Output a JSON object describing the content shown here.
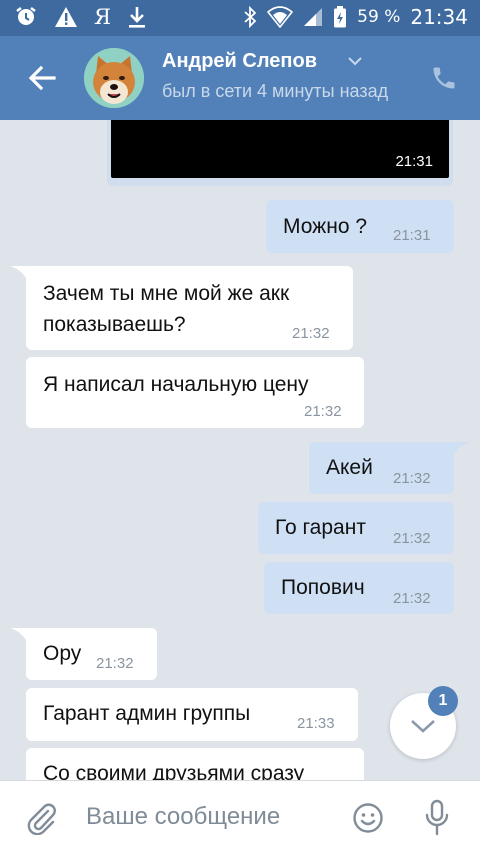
{
  "status_bar": {
    "ya_label": "Я",
    "battery": "59 %",
    "time": "21:34"
  },
  "header": {
    "name": "Андрей Слепов",
    "status": "был в сети 4 минуты назад"
  },
  "chat": {
    "media_time": "21:31",
    "messages": [
      {
        "dir": "out",
        "lines": [
          "Можно ?"
        ],
        "time": "21:31"
      },
      {
        "dir": "in",
        "lines": [
          "Зачем ты мне мой же акк",
          "показываешь?"
        ],
        "time": "21:32"
      },
      {
        "dir": "in",
        "lines": [
          "Я написал начальную цену"
        ],
        "time": "21:32"
      },
      {
        "dir": "out",
        "lines": [
          "Акей"
        ],
        "time": "21:32"
      },
      {
        "dir": "out",
        "lines": [
          "Го гарант"
        ],
        "time": "21:32"
      },
      {
        "dir": "out",
        "lines": [
          "Попович"
        ],
        "time": "21:32"
      },
      {
        "dir": "in",
        "lines": [
          "Ору"
        ],
        "time": "21:32"
      },
      {
        "dir": "in",
        "lines": [
          "Гарант админ группы"
        ],
        "time": "21:33"
      },
      {
        "dir": "in",
        "lines": [
          "Со своими друзьями сразу"
        ],
        "time": ""
      }
    ]
  },
  "scroll_badge": "1",
  "input": {
    "placeholder": "Ваше сообщение"
  },
  "colors": {
    "header": "#5181b8",
    "status_bar": "#3e6a9f",
    "outgoing_bubble": "#cfe0f5",
    "incoming_bubble": "#ffffff",
    "chat_background": "#dfe4eb"
  },
  "icons": [
    "alarm-icon",
    "warning-icon",
    "download-icon",
    "bluetooth-icon",
    "wifi-icon",
    "signal-icon",
    "battery-icon",
    "back-arrow-icon",
    "chevron-down-icon",
    "phone-icon",
    "attach-icon",
    "emoji-icon",
    "microphone-icon",
    "scroll-down-icon"
  ]
}
